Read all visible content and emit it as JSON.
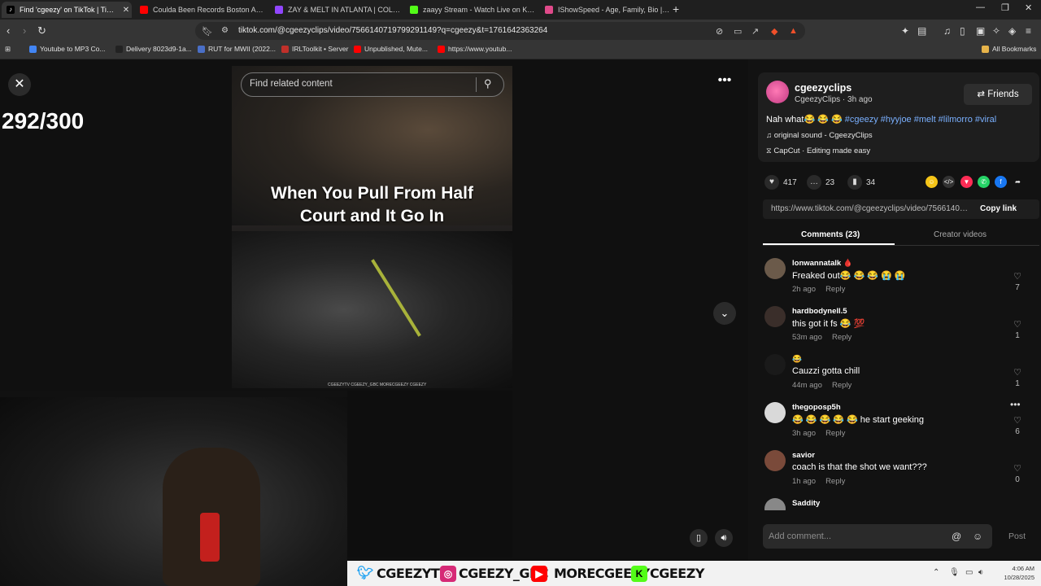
{
  "browser": {
    "tabs": [
      {
        "label": "Find 'cgeezy' on TikTok | TikTo",
        "color": "#000000"
      },
      {
        "label": "Coulda Been Records Boston Auditio",
        "color": "#ff0000"
      },
      {
        "label": "ZAY & MELT IN ATLANTA | COLLEGE",
        "color": "#9146ff"
      },
      {
        "label": "zaayy Stream - Watch Live on Kick",
        "color": "#53fc18"
      },
      {
        "label": "IShowSpeed - Age, Family, Bio | Fame",
        "color": "#e04a8a"
      }
    ],
    "new_tab": "+",
    "url": "tiktok.com/@cgeezyclips/video/7566140719799291149?q=cgeezy&t=1761642363264",
    "bookmarks": [
      "Youtube to MP3 Co...",
      "Delivery 8023d9-1a...",
      "RUT for MWII (2022...",
      "IRLToolkit • Server",
      "Unpublished, Mute...",
      "https://www.youtub..."
    ],
    "all_bookmarks": "All Bookmarks"
  },
  "page": {
    "counter": "292/300",
    "search_placeholder": "Find related content",
    "overlay_text_1": "When You Pull From Half",
    "overlay_text_2": "Court and It Go In",
    "credits": "CGEEZYTV  CGEEZY_GBC  MORECGEEZY  CGEEZY"
  },
  "post": {
    "username": "cgeezyclips",
    "subline": "CgeezyClips · 3h ago",
    "friends_label": "Friends",
    "description": "Nah what😂 😂 😂",
    "hashtags": "#cgeezy #hyyjoe #melt #lilmorro #viral",
    "sound": "original sound - CgeezyClips",
    "capcut": "CapCut · Editing made easy",
    "likes": "417",
    "comments_count": "23",
    "saves": "34",
    "link": "https://www.tiktok.com/@cgeezyclips/video/75661407...",
    "copy_link": "Copy link",
    "tab_comments": "Comments (23)",
    "tab_creator": "Creator videos"
  },
  "comments": [
    {
      "user": "lonwannatalk 🩸",
      "text": "Freaked out😂 😂 😂 😭 😭",
      "time": "2h ago",
      "reply": "Reply",
      "likes": "7",
      "avatar": "#6b5a4a"
    },
    {
      "user": "hardbodynell.5",
      "text": "this got it fs 😂 💯",
      "time": "53m ago",
      "reply": "Reply",
      "likes": "1",
      "avatar": "#3a2e2a"
    },
    {
      "user": "😂",
      "text": "Cauzzi gotta chill",
      "time": "44m ago",
      "reply": "Reply",
      "likes": "1",
      "avatar": "#1a1a1a"
    },
    {
      "user": "thegoposp5h",
      "text": "😂 😂 😂 😂 😂 he start geeking",
      "time": "3h ago",
      "reply": "Reply",
      "likes": "6",
      "avatar": "#d9d9d9"
    },
    {
      "user": "savior",
      "text": "coach is that the shot we want???",
      "time": "1h ago",
      "reply": "Reply",
      "likes": "0",
      "avatar": "#7a4a3a"
    },
    {
      "user": "Saddity",
      "text": "😂 😂 😂 😂 😂 😂 😂 😂 😂",
      "time": "",
      "reply": "",
      "likes": "",
      "avatar": "#888888"
    }
  ],
  "comment_input": {
    "placeholder": "Add comment...",
    "post": "Post"
  },
  "ticker": {
    "twitter": "CGEEZYTV",
    "instagram": "CGEEZY_GBC",
    "youtube": "MORECGEEZY",
    "kick": "CGEEZY"
  },
  "clock": {
    "time": "4:06 AM",
    "date": "10/28/2025"
  }
}
